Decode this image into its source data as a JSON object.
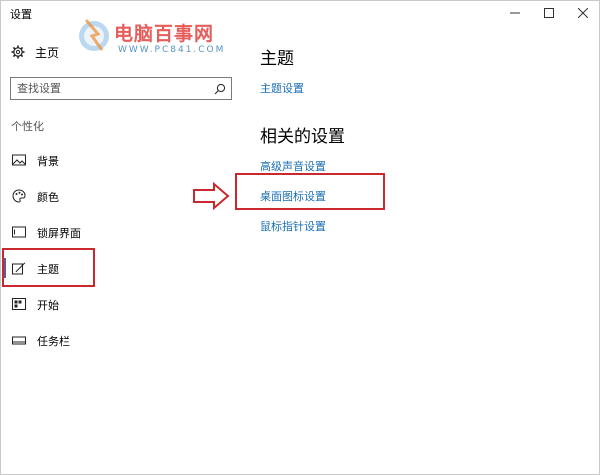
{
  "window": {
    "title": "设置",
    "minimize_icon": "minimize-icon",
    "maximize_icon": "maximize-icon",
    "close_icon": "close-icon"
  },
  "watermark": {
    "title": "电脑百事网",
    "url": "WWW.PC841.COM"
  },
  "sidebar": {
    "home": {
      "label": "主页",
      "icon": "gear-icon"
    },
    "search": {
      "placeholder": "查找设置",
      "icon": "search-icon"
    },
    "section_label": "个性化",
    "items": [
      {
        "label": "背景",
        "icon": "image-icon"
      },
      {
        "label": "颜色",
        "icon": "palette-icon"
      },
      {
        "label": "锁屏界面",
        "icon": "lock-screen-icon"
      },
      {
        "label": "主题",
        "icon": "theme-brush-icon",
        "active": true
      },
      {
        "label": "开始",
        "icon": "start-icon"
      },
      {
        "label": "任务栏",
        "icon": "taskbar-icon"
      }
    ]
  },
  "main": {
    "title": "主题",
    "theme_settings_link": "主题设置",
    "related_title": "相关的设置",
    "related_links": [
      "高级声音设置",
      "桌面图标设置",
      "鼠标指针设置"
    ]
  },
  "colors": {
    "link": "#1a6fb5",
    "annotation_red": "#c8282e",
    "active_accent": "#5b5b9e"
  }
}
